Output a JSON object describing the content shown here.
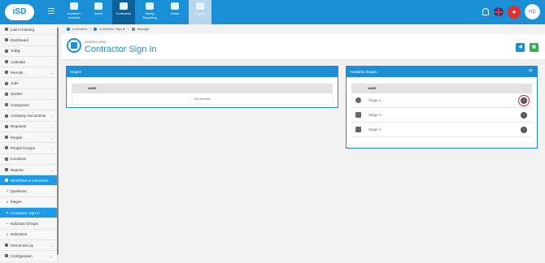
{
  "brand": {
    "logo": "iSD"
  },
  "topnav": [
    {
      "label": "Accident / Incident",
      "icon": "accident-icon",
      "active": false
    },
    {
      "label": "Asset",
      "icon": "asset-icon",
      "active": false
    },
    {
      "label": "Contractor",
      "icon": "contractor-icon",
      "active": true
    },
    {
      "label": "Safety Reporting",
      "icon": "safety-icon",
      "active": false
    },
    {
      "label": "Visitor",
      "icon": "visitor-icon",
      "active": false
    },
    {
      "label": "Payroll",
      "icon": "payroll-icon",
      "active": false
    }
  ],
  "user": {
    "initials": "HD"
  },
  "sidebar": {
    "items": [
      {
        "label": "Liam's training",
        "icon": "training-icon",
        "chevron": "",
        "style": ""
      },
      {
        "label": "Dashboard",
        "icon": "dashboard-icon",
        "chevron": "",
        "style": ""
      },
      {
        "label": "Today",
        "icon": "today-icon",
        "chevron": "",
        "style": ""
      },
      {
        "label": "Calendar",
        "icon": "calendar-icon",
        "chevron": "",
        "style": ""
      },
      {
        "label": "Permits",
        "icon": "permits-icon",
        "chevron": "⌄",
        "style": ""
      },
      {
        "label": "Jobs",
        "icon": "jobs-icon",
        "chevron": "",
        "style": ""
      },
      {
        "label": "Quotes",
        "icon": "quotes-icon",
        "chevron": "",
        "style": ""
      },
      {
        "label": "Companies",
        "icon": "companies-icon",
        "chevron": "",
        "style": ""
      },
      {
        "label": "Company Documents",
        "icon": "documents-icon",
        "chevron": "⌄",
        "style": ""
      },
      {
        "label": "Requests",
        "icon": "requests-icon",
        "chevron": "⌄",
        "style": ""
      },
      {
        "label": "People",
        "icon": "people-icon",
        "chevron": "⌄",
        "style": ""
      },
      {
        "label": "People Groups",
        "icon": "people-groups-icon",
        "chevron": "⌄",
        "style": ""
      },
      {
        "label": "Locations",
        "icon": "locations-icon",
        "chevron": "",
        "style": ""
      },
      {
        "label": "Reports",
        "icon": "reports-icon",
        "chevron": "⌄",
        "style": ""
      },
      {
        "label": "Workflows & Inductions",
        "icon": "workflows-icon",
        "chevron": "⌃",
        "style": "highlight"
      },
      {
        "label": "Questions",
        "icon": "bullet-icon",
        "chevron": "",
        "style": "sub"
      },
      {
        "label": "Stages",
        "icon": "bullet-icon",
        "chevron": "",
        "style": "sub"
      },
      {
        "label": "Contractor Sign In",
        "icon": "bullet-icon",
        "chevron": "",
        "style": "sub active-sub"
      },
      {
        "label": "Induction Groups",
        "icon": "bullet-icon",
        "chevron": "",
        "style": "sub"
      },
      {
        "label": "Inductions",
        "icon": "bullet-icon",
        "chevron": "",
        "style": "sub"
      },
      {
        "label": "Permit Set Up",
        "icon": "permit-setup-icon",
        "chevron": "⌄",
        "style": ""
      },
      {
        "label": "Configuration",
        "icon": "configuration-icon",
        "chevron": "⌄",
        "style": ""
      }
    ]
  },
  "breadcrumb": [
    "Contractor",
    "Contractor Sign In",
    "Manage"
  ],
  "header": {
    "subtitle": "WORKFLOWS",
    "title": "Contractor Sign In"
  },
  "stages_panel": {
    "title": "Stages",
    "column": "NAME",
    "empty_text": "No records"
  },
  "available_panel": {
    "title": "Available Stages",
    "column": "NAME",
    "rows": [
      {
        "label": "Stage 1",
        "icon": "check-circle-icon"
      },
      {
        "label": "Stage 2",
        "icon": "building-icon"
      },
      {
        "label": "Stage 3",
        "icon": "building-icon"
      }
    ]
  }
}
